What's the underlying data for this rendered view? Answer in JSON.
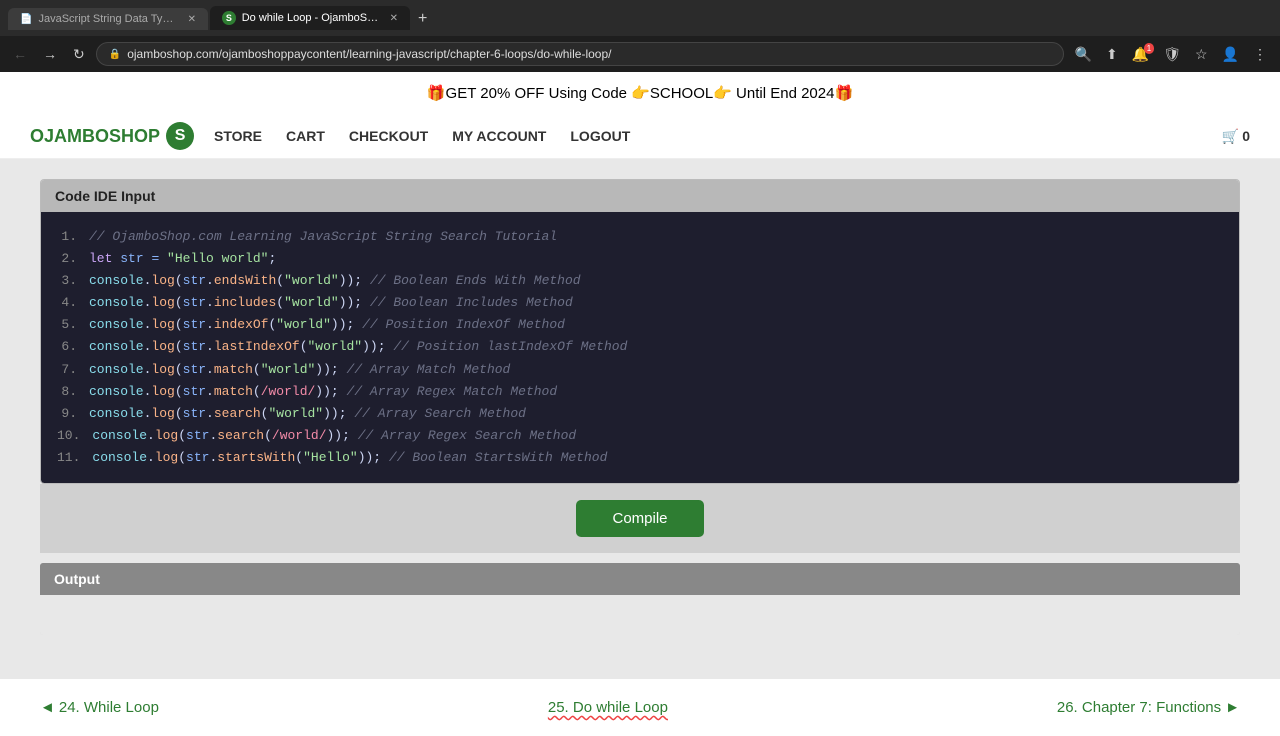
{
  "browser": {
    "tabs": [
      {
        "id": "tab1",
        "label": "JavaScript String Data Type - O...",
        "favicon": "📄",
        "active": false
      },
      {
        "id": "tab2",
        "label": "Do while Loop - OjamboSh...",
        "favicon": "S",
        "active": true
      }
    ],
    "url": "ojamboshop.com/ojamboshoppaycontent/learning-javascript/chapter-6-loops/do-while-loop/",
    "new_tab_label": "+"
  },
  "promo": {
    "text": "🎁GET 20% OFF Using Code 👉SCHOOL👉 Until End 2024🎁"
  },
  "nav": {
    "logo": "OJAMBOSHOP",
    "logo_s": "S",
    "store": "STORE",
    "cart": "CART",
    "checkout": "CHECKOUT",
    "my_account": "MY ACCOUNT",
    "logout": "LOGOUT",
    "cart_count": "0"
  },
  "code_ide": {
    "header": "Code IDE Input",
    "lines": [
      {
        "num": "1.",
        "text": "// OjamboShop.com Learning JavaScript String Search Tutorial"
      },
      {
        "num": "2.",
        "text": "let str = \"Hello world\";"
      },
      {
        "num": "3.",
        "text": "console.log(str.endsWith(\"world\")); // Boolean Ends With Method"
      },
      {
        "num": "4.",
        "text": "console.log(str.includes(\"world\")); // Boolean Includes Method"
      },
      {
        "num": "5.",
        "text": "console.log(str.indexOf(\"world\")); // Position IndexOf Method"
      },
      {
        "num": "6.",
        "text": "console.log(str.lastIndexOf(\"world\")); // Position lastIndexOf Method"
      },
      {
        "num": "7.",
        "text": "console.log(str.match(\"world\")); // Array Match Method"
      },
      {
        "num": "8.",
        "text": "console.log(str.match(/world/)); // Array Regex Match Method"
      },
      {
        "num": "9.",
        "text": "console.log(str.search(\"world\")); // Array Search Method"
      },
      {
        "num": "10.",
        "text": "console.log(str.search(/world/)); // Array Regex Search Method"
      },
      {
        "num": "11.",
        "text": "console.log(str.startsWith(\"Hello\")); // Boolean StartsWith Method"
      }
    ]
  },
  "compile_btn": "Compile",
  "output": {
    "header": "Output",
    "body": ""
  },
  "nav_footer": {
    "prev_arrow": "◄",
    "prev_label": "24. While Loop",
    "current_label": "25. Do while Loop",
    "next_label": "26. Chapter 7: Functions",
    "next_arrow": "►"
  }
}
